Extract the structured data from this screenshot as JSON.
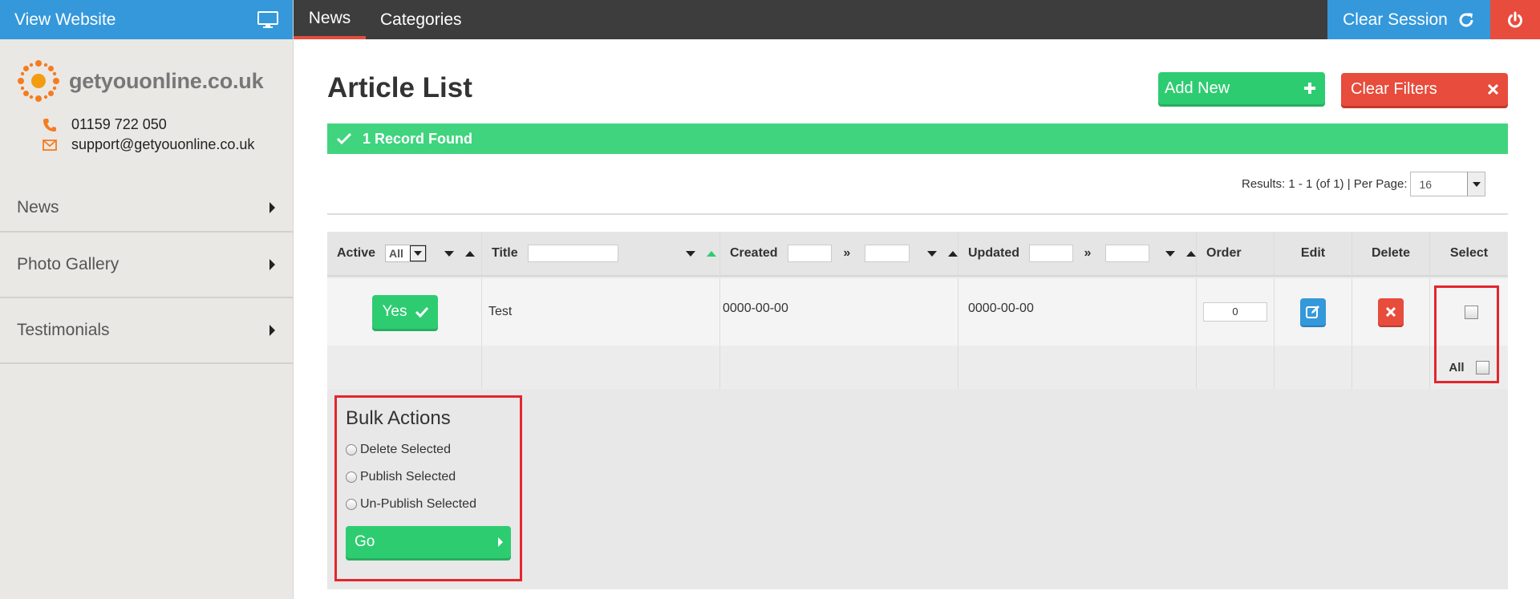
{
  "sidebar": {
    "view_website": "View Website",
    "brand_name": "getyouonline.co.uk",
    "phone": "01159 722 050",
    "email": "support@getyouonline.co.uk",
    "items": [
      {
        "label": "News"
      },
      {
        "label": "Photo Gallery"
      },
      {
        "label": "Testimonials"
      }
    ]
  },
  "topbar": {
    "tabs": [
      {
        "label": "News",
        "active": true
      },
      {
        "label": "Categories",
        "active": false
      }
    ],
    "clear_session": "Clear Session"
  },
  "main": {
    "title": "Article List",
    "add_new": "Add New",
    "clear_filters": "Clear Filters",
    "records_found": "1 Record Found",
    "results_label": "Results: 1 - 1 (of 1) | Per Page:",
    "per_page": "16"
  },
  "table": {
    "headers": {
      "active": "Active",
      "active_filter": "All",
      "title": "Title",
      "created": "Created",
      "updated": "Updated",
      "order": "Order",
      "edit": "Edit",
      "delete": "Delete",
      "select": "Select"
    },
    "rows": [
      {
        "active": "Yes",
        "title": "Test",
        "created": "0000-00-00",
        "updated": "0000-00-00",
        "order": "0"
      }
    ],
    "select_all_label": "All"
  },
  "bulk_actions": {
    "title": "Bulk Actions",
    "options": [
      "Delete Selected",
      "Publish Selected",
      "Un-Publish Selected"
    ],
    "go": "Go"
  },
  "colors": {
    "blue": "#3498db",
    "green": "#2ecc71",
    "red": "#e74c3c",
    "topbar": "#3d3d3d",
    "highlight_box": "#e3262e"
  }
}
